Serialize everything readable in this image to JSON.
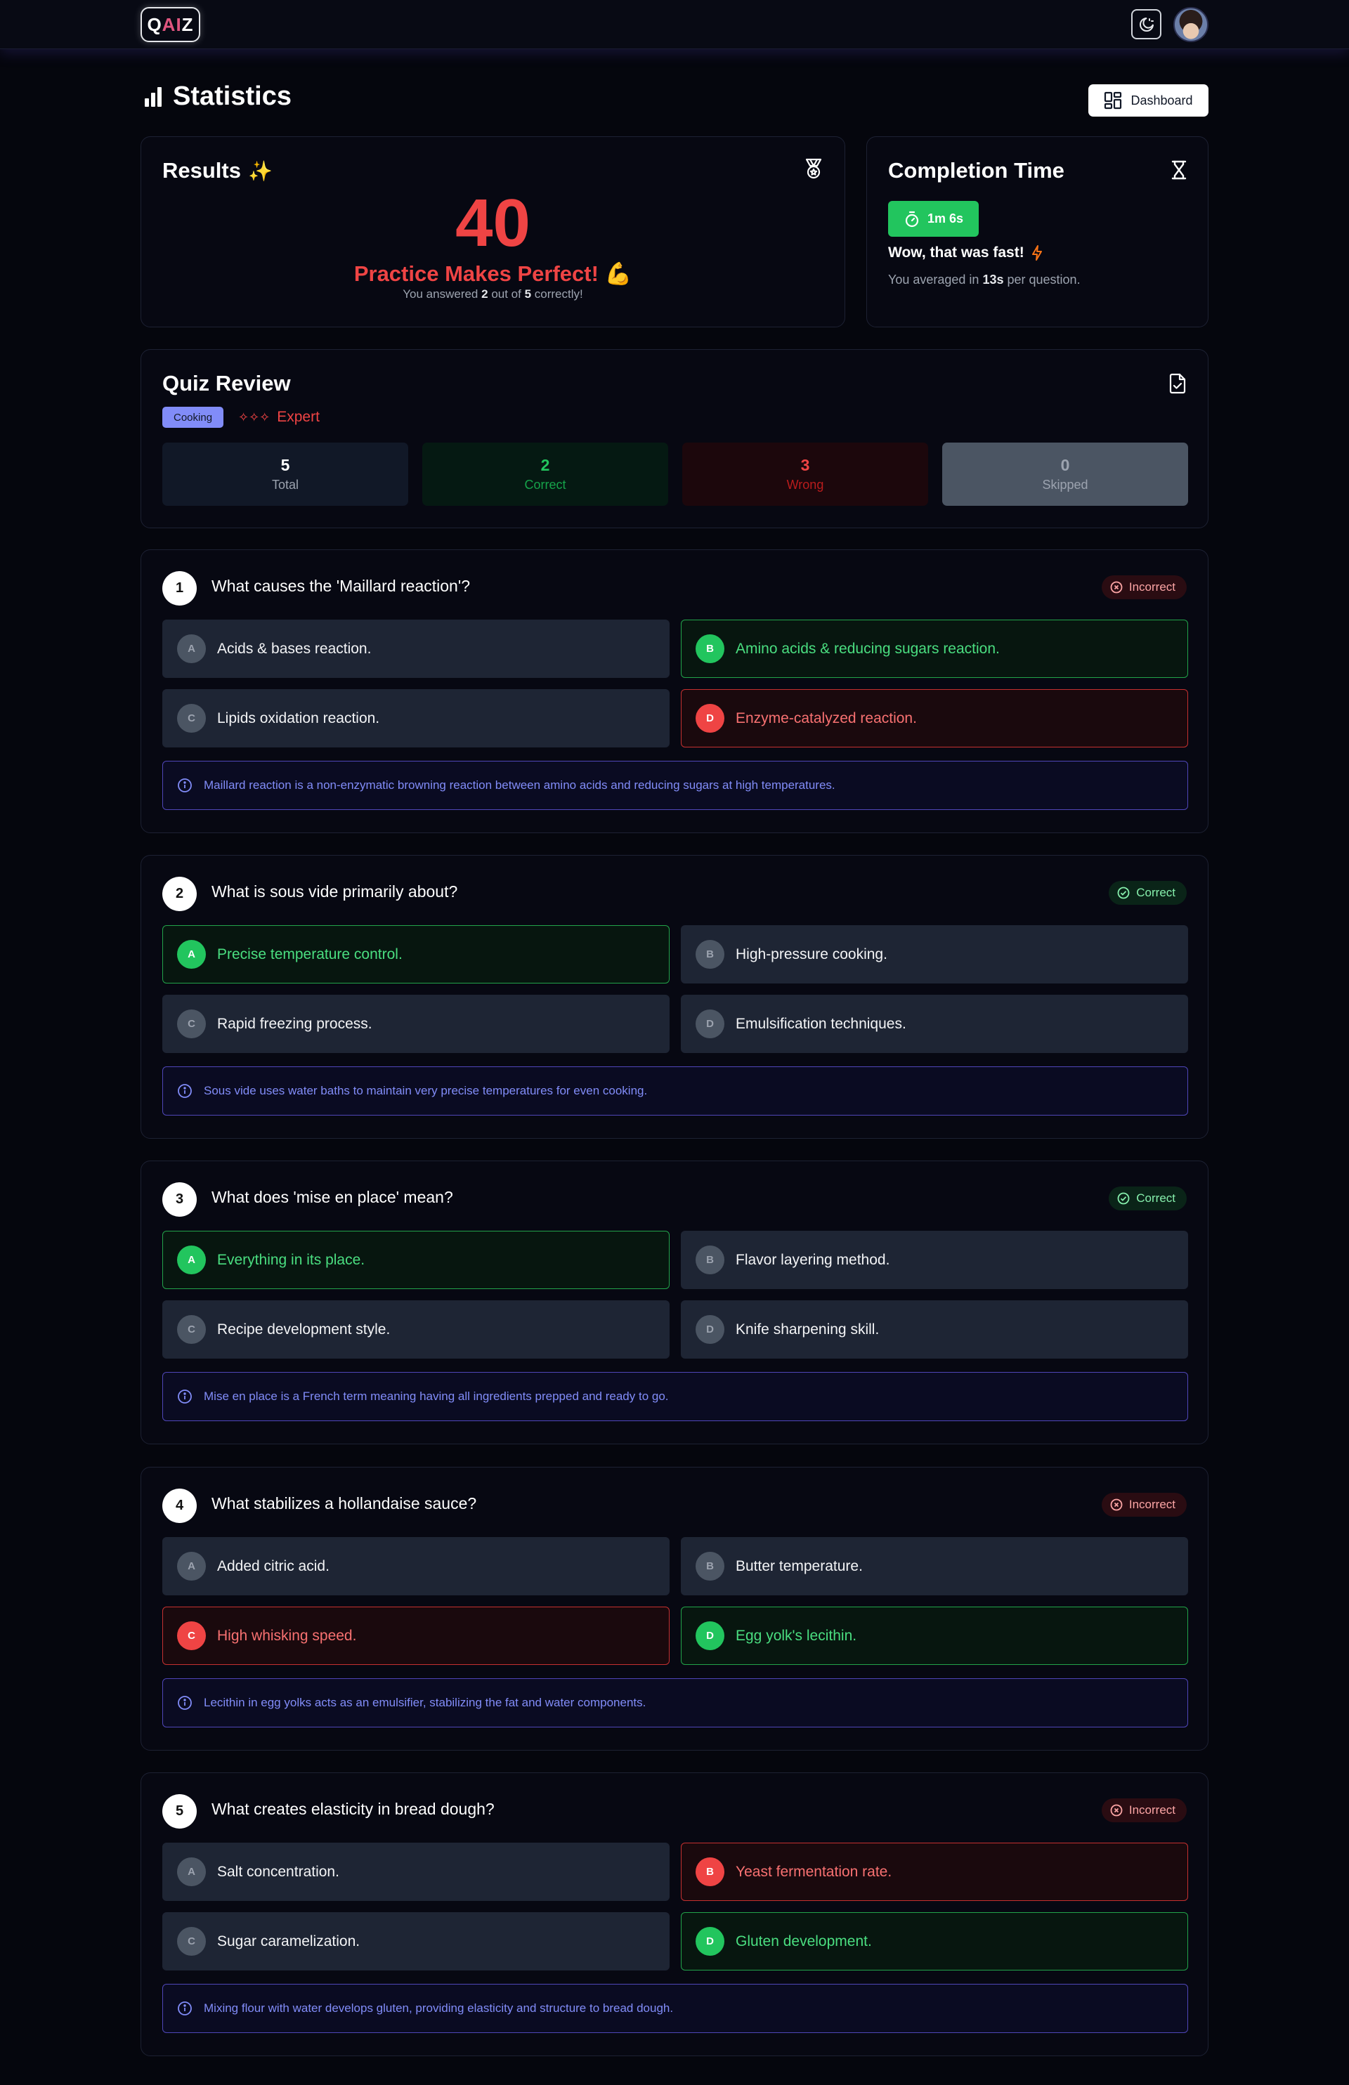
{
  "app": {
    "logo_q": "Q",
    "logo_ai": "AI",
    "logo_z": "Z"
  },
  "header": {
    "title": "Statistics",
    "dashboard_label": "Dashboard"
  },
  "results": {
    "title": "Results",
    "title_emoji": "✨",
    "score": "40",
    "message": "Practice Makes Perfect!",
    "message_emoji": "💪",
    "answered_prefix": "You answered ",
    "correct_count": "2",
    "answered_mid": " out of ",
    "total_count": "5",
    "answered_suffix": " correctly!"
  },
  "completion": {
    "title": "Completion Time",
    "time": "1m 6s",
    "wow": "Wow, that was fast!",
    "avg_prefix": "You averaged in ",
    "avg_value": "13s",
    "avg_suffix": " per question."
  },
  "review": {
    "title": "Quiz Review",
    "category": "Cooking",
    "level_stars": "✧✧✧",
    "level": "Expert",
    "stats": [
      {
        "value": "5",
        "label": "Total"
      },
      {
        "value": "2",
        "label": "Correct"
      },
      {
        "value": "3",
        "label": "Wrong"
      },
      {
        "value": "0",
        "label": "Skipped"
      }
    ]
  },
  "questions": [
    {
      "number": "1",
      "text": "What causes the 'Maillard reaction'?",
      "status": "Incorrect",
      "options": [
        {
          "letter": "A",
          "text": "Acids & bases reaction."
        },
        {
          "letter": "B",
          "text": "Amino acids & reducing sugars reaction."
        },
        {
          "letter": "C",
          "text": "Lipids oxidation reaction."
        },
        {
          "letter": "D",
          "text": "Enzyme-catalyzed reaction."
        }
      ],
      "explanation": "Maillard reaction is a non-enzymatic browning reaction between amino acids and reducing sugars at high temperatures."
    },
    {
      "number": "2",
      "text": "What is sous vide primarily about?",
      "status": "Correct",
      "options": [
        {
          "letter": "A",
          "text": "Precise temperature control."
        },
        {
          "letter": "B",
          "text": "High-pressure cooking."
        },
        {
          "letter": "C",
          "text": "Rapid freezing process."
        },
        {
          "letter": "D",
          "text": "Emulsification techniques."
        }
      ],
      "explanation": "Sous vide uses water baths to maintain very precise temperatures for even cooking."
    },
    {
      "number": "3",
      "text": "What does 'mise en place' mean?",
      "status": "Correct",
      "options": [
        {
          "letter": "A",
          "text": "Everything in its place."
        },
        {
          "letter": "B",
          "text": "Flavor layering method."
        },
        {
          "letter": "C",
          "text": "Recipe development style."
        },
        {
          "letter": "D",
          "text": "Knife sharpening skill."
        }
      ],
      "explanation": "Mise en place is a French term meaning having all ingredients prepped and ready to go."
    },
    {
      "number": "4",
      "text": "What stabilizes a hollandaise sauce?",
      "status": "Incorrect",
      "options": [
        {
          "letter": "A",
          "text": "Added citric acid."
        },
        {
          "letter": "B",
          "text": "Butter temperature."
        },
        {
          "letter": "C",
          "text": "High whisking speed."
        },
        {
          "letter": "D",
          "text": "Egg yolk's lecithin."
        }
      ],
      "explanation": "Lecithin in egg yolks acts as an emulsifier, stabilizing the fat and water components."
    },
    {
      "number": "5",
      "text": "What creates elasticity in bread dough?",
      "status": "Incorrect",
      "options": [
        {
          "letter": "A",
          "text": "Salt concentration."
        },
        {
          "letter": "B",
          "text": "Yeast fermentation rate."
        },
        {
          "letter": "C",
          "text": "Sugar caramelization."
        },
        {
          "letter": "D",
          "text": "Gluten development."
        }
      ],
      "explanation": "Mixing flour with water develops gluten, providing elasticity and structure to bread dough."
    }
  ],
  "colors": {
    "accent": "#ef4444",
    "success": "#22c55e",
    "info": "#818cf8",
    "card": "#070812"
  },
  "icons": [
    "theme-toggle-icon",
    "bar-chart-icon",
    "dashboard-grid-icon",
    "medal-icon",
    "hourglass-icon",
    "stopwatch-icon",
    "lightning-icon",
    "file-check-icon",
    "x-circle-icon",
    "check-circle-icon",
    "info-icon"
  ]
}
